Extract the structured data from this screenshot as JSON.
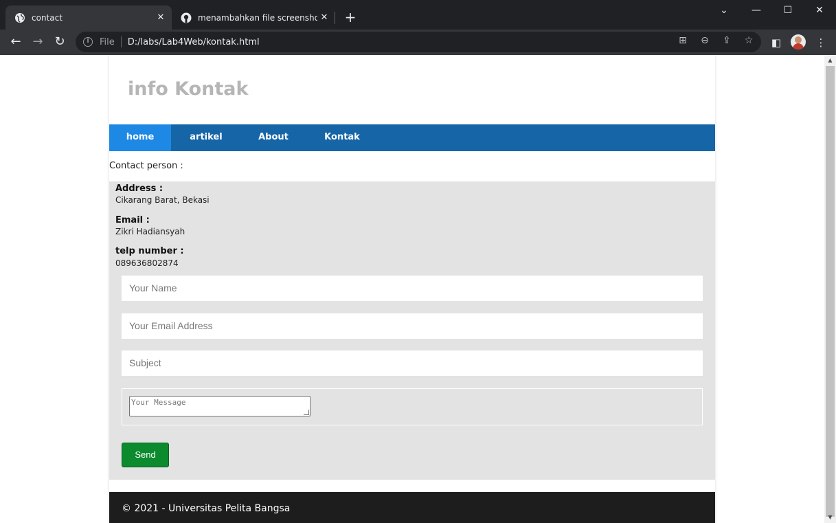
{
  "browser": {
    "tabs": [
      {
        "title": "contact",
        "active": true
      },
      {
        "title": "menambahkan file screenshot · z",
        "active": false
      }
    ],
    "address": {
      "scheme_label": "File",
      "url": "D:/labs/Lab4Web/kontak.html"
    },
    "icons": [
      "globe-icon",
      "github-icon",
      "back-icon",
      "forward-icon",
      "reload-icon",
      "translate-icon",
      "zoom-out-icon",
      "share-icon",
      "star-icon",
      "side-panel-icon",
      "profile-avatar",
      "menu-icon"
    ]
  },
  "page": {
    "title": "info Kontak",
    "nav": [
      {
        "label": "home",
        "active": true
      },
      {
        "label": "artikel",
        "active": false
      },
      {
        "label": "About",
        "active": false
      },
      {
        "label": "Kontak",
        "active": false
      }
    ],
    "contact_lead": "Contact person :",
    "info": [
      {
        "label": "Address :",
        "value": "Cikarang Barat, Bekasi"
      },
      {
        "label": "Email :",
        "value": "Zikri Hadiansyah"
      },
      {
        "label": "telp number :",
        "value": "089636802874"
      }
    ],
    "form": {
      "name_placeholder": "Your Name",
      "email_placeholder": "Your Email Address",
      "subject_placeholder": "Subject",
      "message_placeholder": "Your Message",
      "send_label": "Send"
    },
    "footer": "© 2021 - Universitas Pelita Bangsa"
  },
  "colors": {
    "navbar": "#1565a7",
    "nav_active": "#1e88e5",
    "panel": "#e3e3e3",
    "send_button": "#0b8a2e",
    "footer": "#1d1d1d"
  }
}
